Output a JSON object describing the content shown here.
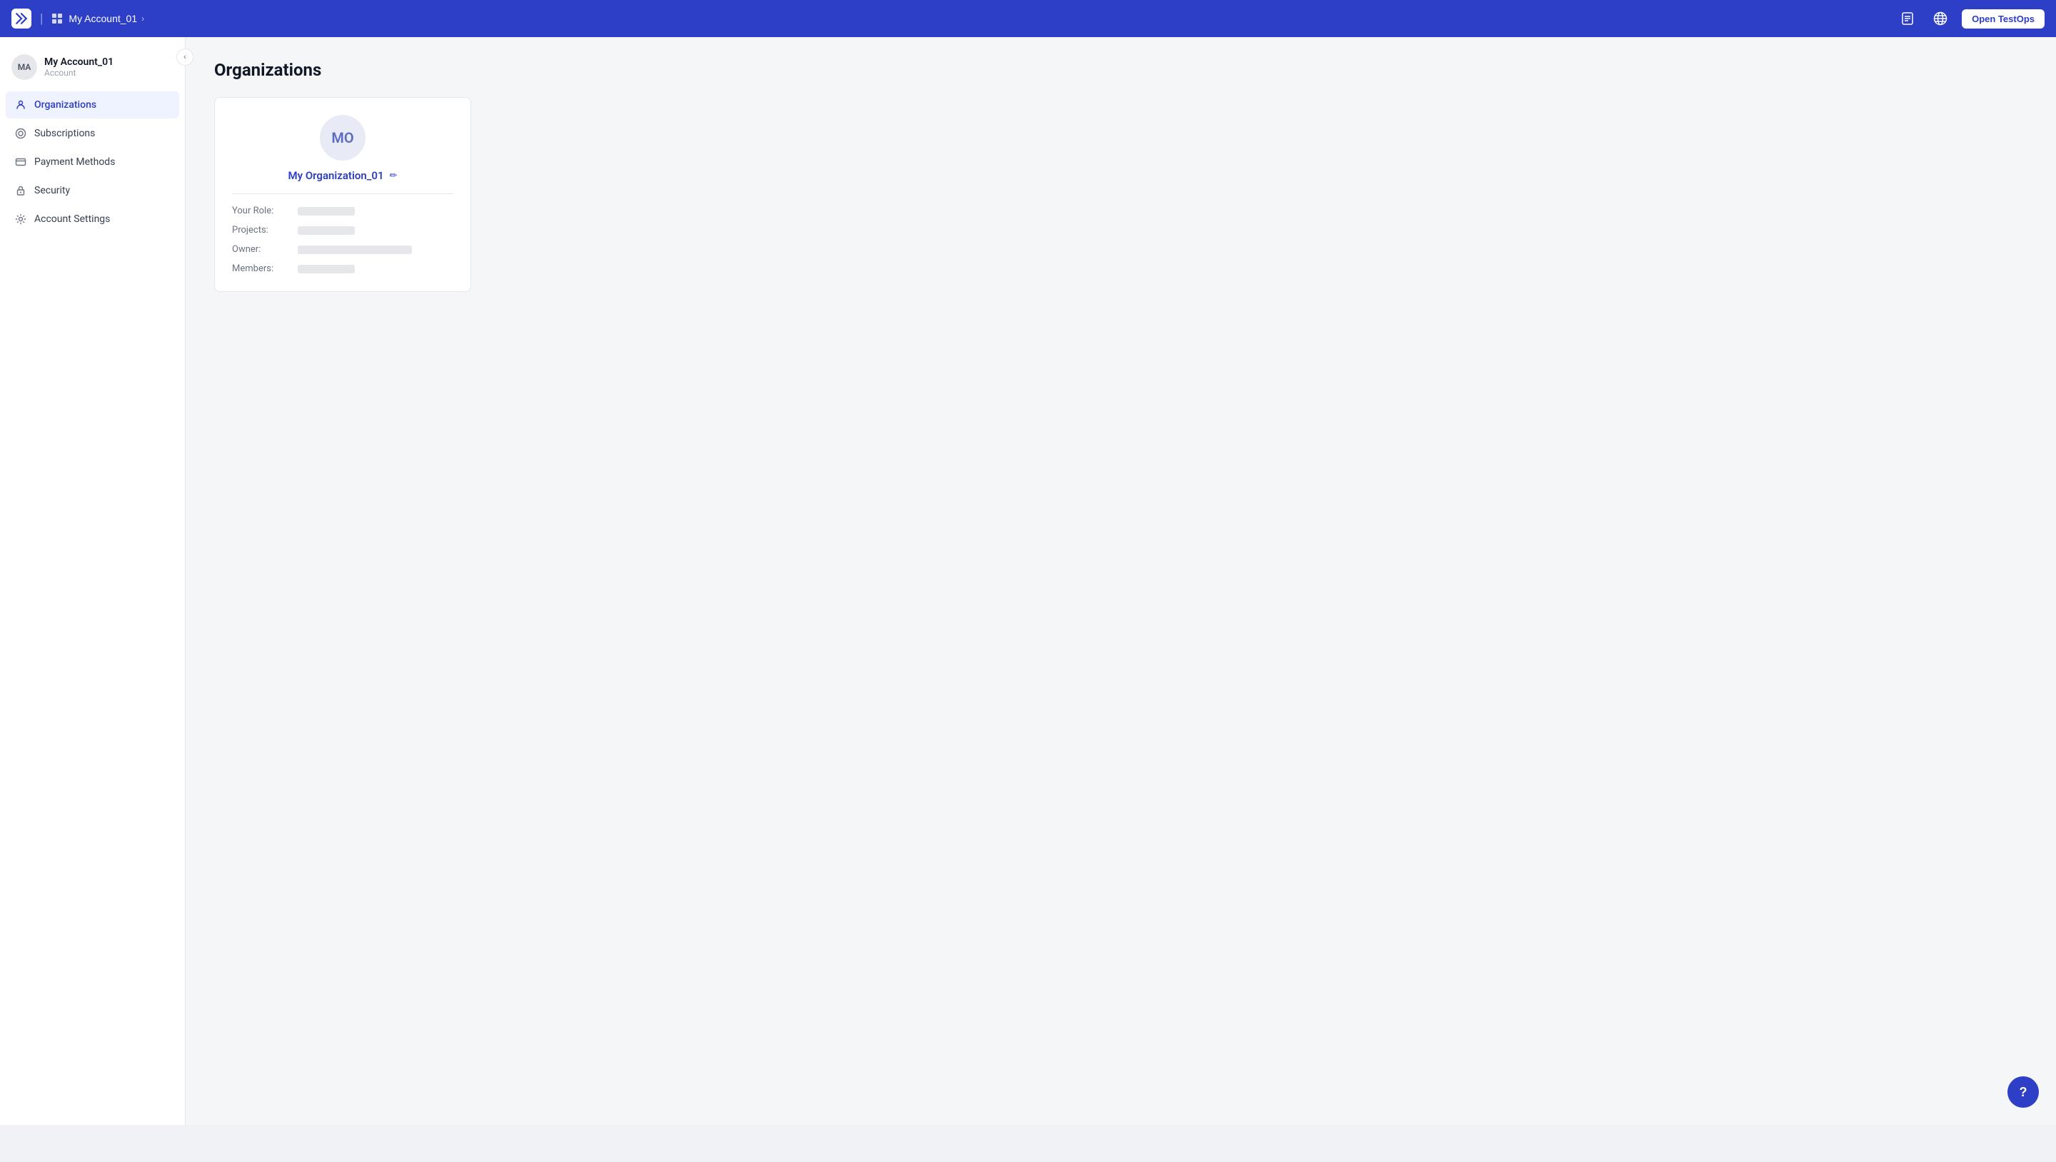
{
  "navbar": {
    "logo_alt": "Katalon logo",
    "account_name": "My Account_01",
    "chevron": "›",
    "open_testops_label": "Open TestOps",
    "docs_icon": "docs-icon",
    "globe_icon": "globe-icon"
  },
  "sidebar": {
    "collapse_icon": "‹",
    "user": {
      "initials": "MA",
      "name": "My Account_01",
      "role": "Account"
    },
    "nav_items": [
      {
        "id": "organizations",
        "label": "Organizations",
        "icon": "org-icon",
        "active": true
      },
      {
        "id": "subscriptions",
        "label": "Subscriptions",
        "icon": "subscriptions-icon",
        "active": false
      },
      {
        "id": "payment-methods",
        "label": "Payment Methods",
        "icon": "payment-icon",
        "active": false
      },
      {
        "id": "security",
        "label": "Security",
        "icon": "security-icon",
        "active": false
      },
      {
        "id": "account-settings",
        "label": "Account Settings",
        "icon": "settings-icon",
        "active": false
      }
    ]
  },
  "main": {
    "page_title": "Organizations",
    "org_card": {
      "avatar_initials": "MO",
      "org_name": "My Organization_01",
      "edit_icon": "✏",
      "details": [
        {
          "label": "Your Role:",
          "value_width": "short"
        },
        {
          "label": "Projects:",
          "value_width": "short"
        },
        {
          "label": "Owner:",
          "value_width": "wide"
        },
        {
          "label": "Members:",
          "value_width": "short"
        }
      ]
    }
  },
  "help": {
    "label": "?"
  }
}
